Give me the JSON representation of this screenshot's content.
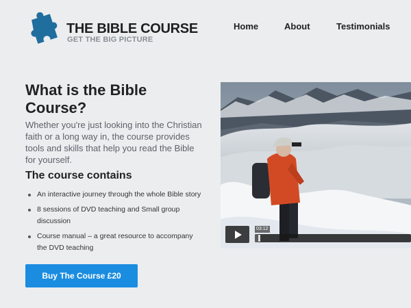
{
  "brand": {
    "title": "THE BIBLE COURSE",
    "tagline": "GET THE BIG PICTURE",
    "logo_icon": "puzzle-piece-icon",
    "logo_color": "#1f6e9e"
  },
  "nav": {
    "home": "Home",
    "about": "About",
    "testimonials": "Testimonials"
  },
  "intro": {
    "heading": "What is the Bible Course?",
    "text": "Whether you're just looking into the Christian faith or a long way in, the course provides tools and skills that help you read the Bible for yourself."
  },
  "contents": {
    "heading": "The course contains",
    "items": [
      "An interactive journey through the whole Bible story",
      "8 sessions of DVD teaching and Small group discussion",
      "Course manual – a great resource to accompany the DVD teaching"
    ]
  },
  "cta": {
    "label": "Buy The Course £20",
    "color": "#1b8de0"
  },
  "video": {
    "timestamp": "03:12",
    "play_icon": "play-icon",
    "progress": 0.02
  }
}
